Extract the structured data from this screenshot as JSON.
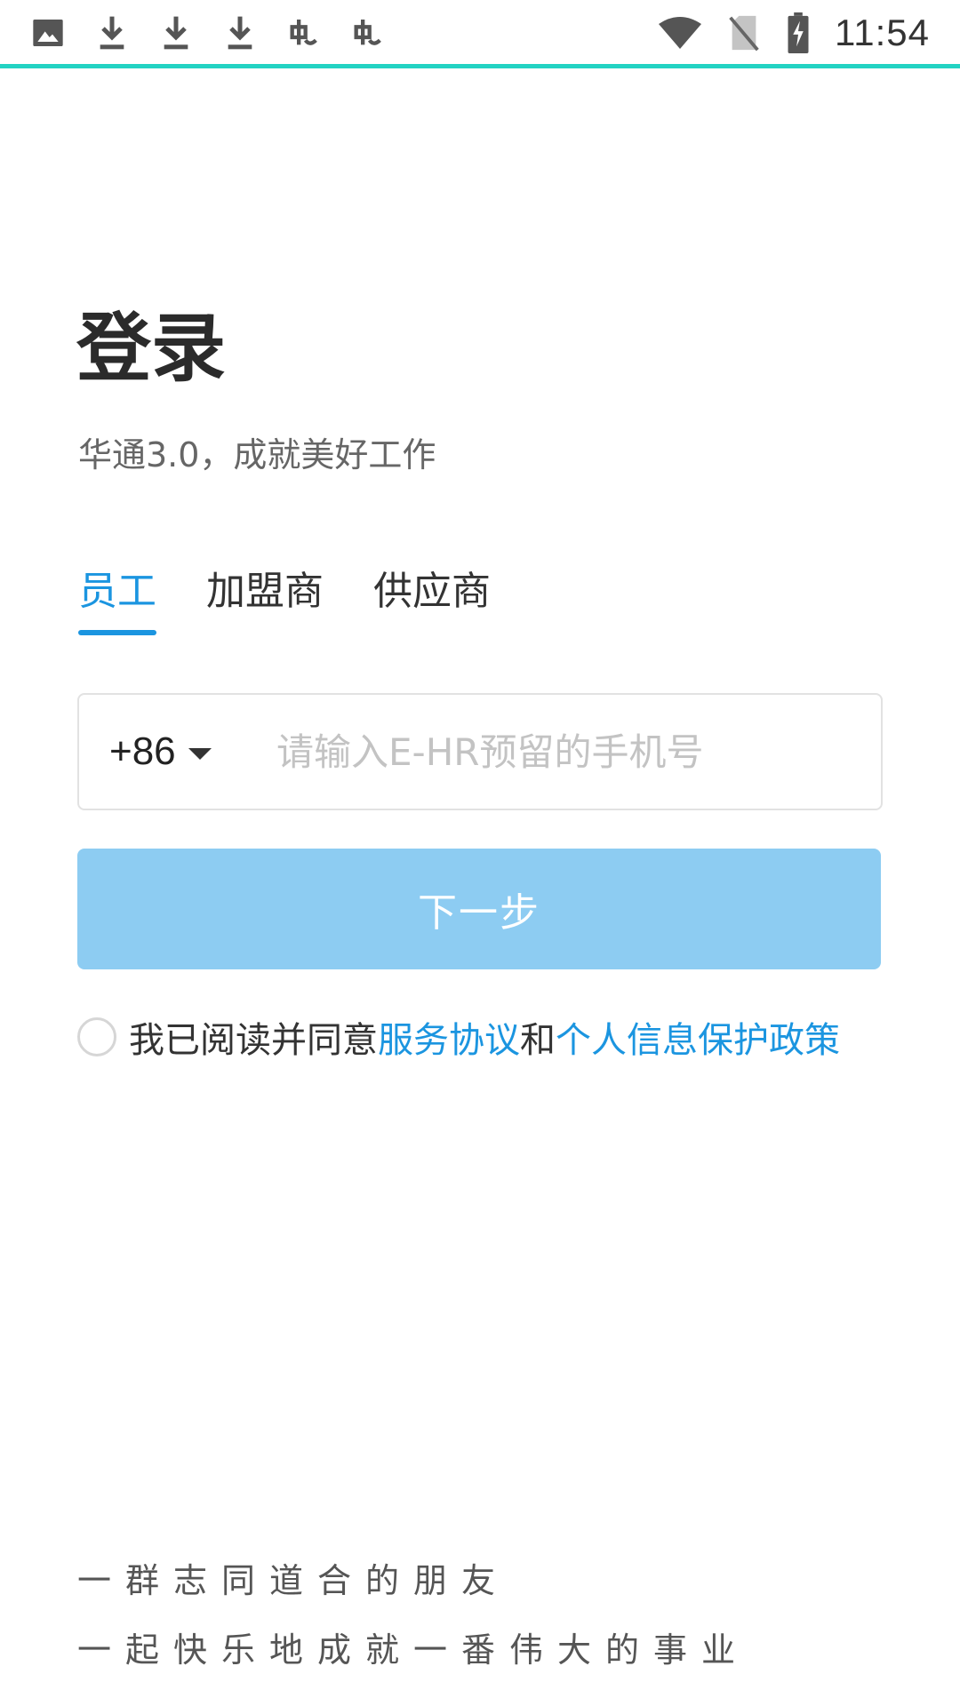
{
  "status_bar": {
    "time": "11:54",
    "left_icons": [
      "image-icon",
      "download-icon",
      "download-icon",
      "download-icon",
      "bug-icon",
      "bug-icon"
    ],
    "right_icons": [
      "wifi-icon",
      "no-sim-icon",
      "battery-charging-icon"
    ],
    "accent_color": "#22d3c3"
  },
  "header": {
    "title": "登录",
    "subtitle": "华通3.0，成就美好工作"
  },
  "tabs": [
    {
      "label": "员工",
      "active": true
    },
    {
      "label": "加盟商",
      "active": false
    },
    {
      "label": "供应商",
      "active": false
    }
  ],
  "phone": {
    "country_code": "+86",
    "value": "",
    "placeholder": "请输入E-HR预留的手机号"
  },
  "next_button": {
    "label": "下一步",
    "color": "#8dccf2"
  },
  "agreement": {
    "checked": false,
    "prefix": "我已阅读并同意",
    "service_link": "服务协议",
    "conjunction": "和",
    "privacy_link": "个人信息保护政策",
    "link_color": "#1b95e0"
  },
  "slogan": {
    "line1": "一群志同道合的朋友",
    "line2": "一起快乐地成就一番伟大的事业"
  }
}
